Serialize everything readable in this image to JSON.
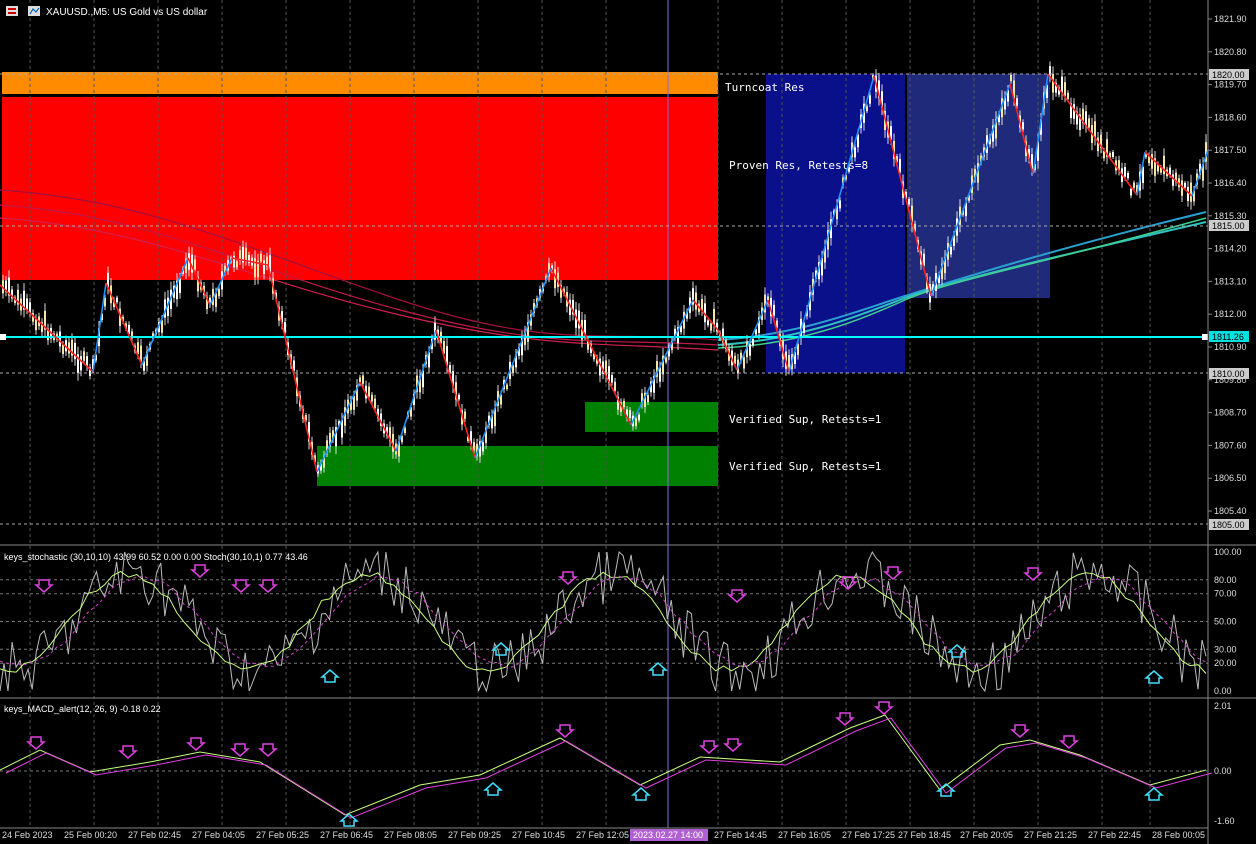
{
  "header": {
    "title": "XAUUSD.,M5:  US Gold vs US dollar"
  },
  "zones": {
    "turncoat": "Turncoat Res",
    "proven": "Proven Res, Retests=8",
    "sup1": "Verified Sup, Retests=1",
    "sup2": "Verified Sup, Retests=1"
  },
  "price_axis": {
    "ticks": [
      "1821.90",
      "1820.80",
      "1819.70",
      "1818.60",
      "1817.50",
      "1816.40",
      "1815.30",
      "1814.20",
      "1813.10",
      "1812.00",
      "1810.90",
      "1809.80",
      "1808.70",
      "1807.60",
      "1806.50",
      "1805.40"
    ],
    "marker_top": "1820.00",
    "marker_mid": "1815.00",
    "marker_cyan": "1811.26",
    "marker_low": "1810.00",
    "marker_bottom": "1805.00"
  },
  "stoch": {
    "title": "keys_stochastic (30,10,10) 43.99 60.52 0.00 0.00 Stoch(30,10,1) 0.77 43.46",
    "levels": [
      "100.00",
      "80.00",
      "70.00",
      "50.00",
      "30.00",
      "20.00",
      "0.00"
    ]
  },
  "macd": {
    "title": "keys_MACD_alert(12, 26, 9) -0.18 0.22",
    "levels": [
      "2.01",
      "0.00",
      "-1.60"
    ]
  },
  "time_axis": {
    "labels": [
      "24 Feb 2023",
      "25 Feb 00:20",
      "27 Feb 02:45",
      "27 Feb 04:05",
      "27 Feb 05:25",
      "27 Feb 06:45",
      "27 Feb 08:05",
      "27 Feb 09:25",
      "27 Feb 10:45",
      "27 Feb 12:05",
      "27 Feb 14:45",
      "27 Feb 16:05",
      "27 Feb 17:25",
      "27 Feb 18:45",
      "27 Feb 20:05",
      "27 Feb 21:25",
      "27 Feb 22:45",
      "28 Feb 00:05"
    ],
    "cursor": "2023.02.27 14:00"
  },
  "colors": {
    "bg": "#000000",
    "grid": "#8a8a8a",
    "resistance": "#ff0000",
    "turncoat": "#ff8c00",
    "support": "#008000",
    "zigzag_up": "#1e90ff",
    "zigzag_down": "#ff2020",
    "ma_cyan": "#00ffff",
    "box_dark": "#0a0f8a",
    "box_light": "#1f2a7a"
  }
}
